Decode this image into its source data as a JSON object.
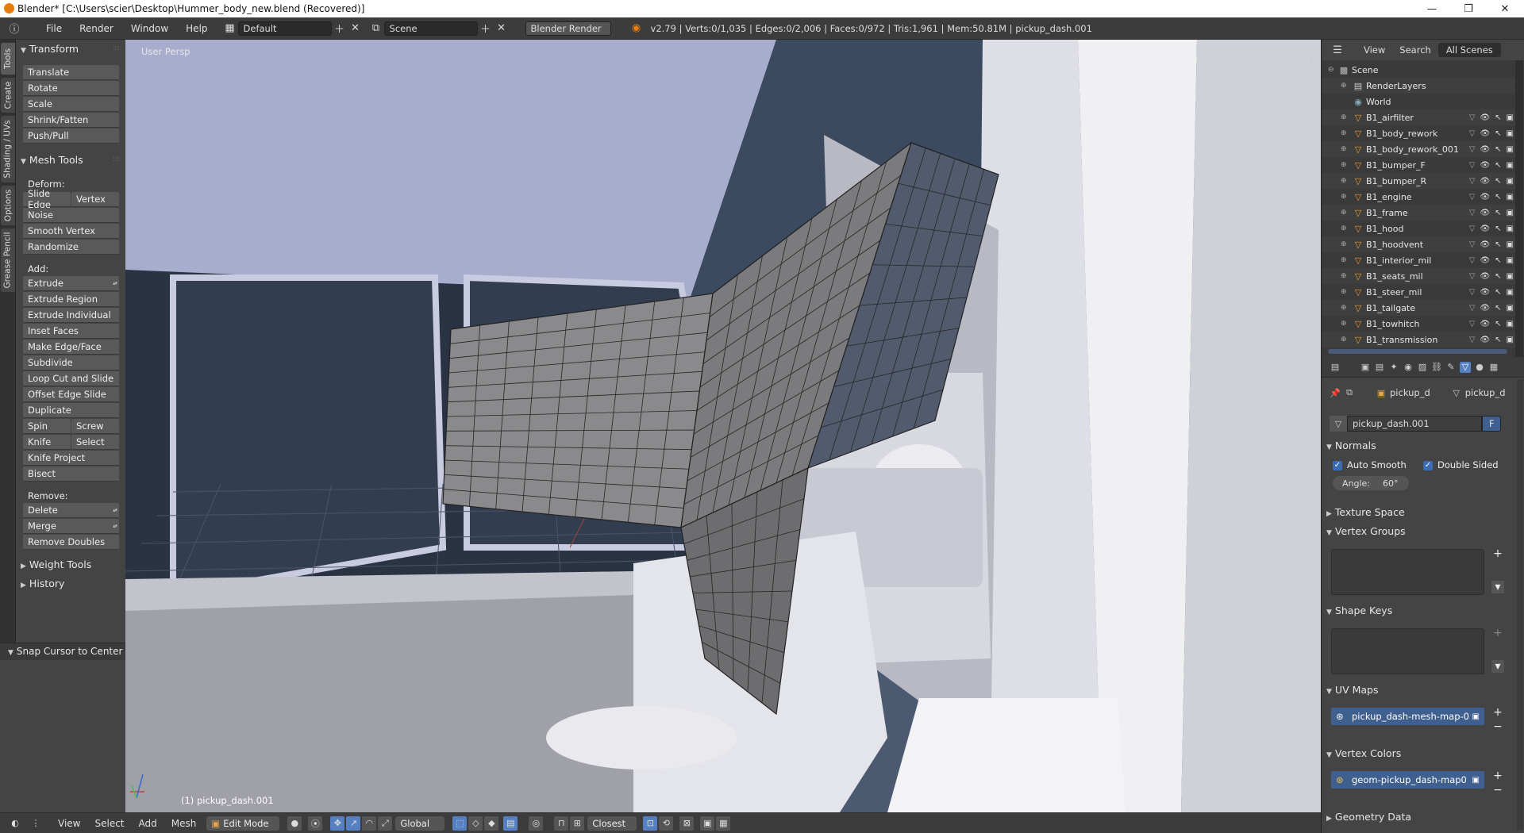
{
  "window": {
    "title": "Blender* [C:\\Users\\scier\\Desktop\\Hummer_body_new.blend (Recovered)]",
    "minimize": "—",
    "maximize": "❐",
    "close": "✕"
  },
  "infobar": {
    "menus": [
      "File",
      "Render",
      "Window",
      "Help"
    ],
    "layout": "Default",
    "scene": "Scene",
    "engine": "Blender Render",
    "stats": "v2.79 | Verts:0/1,035 | Edges:0/2,006 | Faces:0/972 | Tris:1,961 | Mem:50.81M | pickup_dash.001"
  },
  "tool_tabs": [
    "Tools",
    "Create",
    "Shading / UVs",
    "Options",
    "Grease Pencil"
  ],
  "toolshelf": {
    "transform": {
      "title": "Transform",
      "buttons": [
        "Translate",
        "Rotate",
        "Scale",
        "Shrink/Fatten",
        "Push/Pull"
      ]
    },
    "mesh_tools": {
      "title": "Mesh Tools",
      "deform_label": "Deform:",
      "slide_edge": "Slide Edge",
      "vertex": "Vertex",
      "noise": "Noise",
      "smooth_vertex": "Smooth Vertex",
      "randomize": "Randomize",
      "add_label": "Add:",
      "extrude": "Extrude",
      "extrude_region": "Extrude Region",
      "extrude_individual": "Extrude Individual",
      "inset_faces": "Inset Faces",
      "make_edge_face": "Make Edge/Face",
      "subdivide": "Subdivide",
      "loop_cut": "Loop Cut and Slide",
      "offset_edge": "Offset Edge Slide",
      "duplicate": "Duplicate",
      "spin": "Spin",
      "screw": "Screw",
      "knife": "Knife",
      "select": "Select",
      "knife_project": "Knife Project",
      "bisect": "Bisect",
      "remove_label": "Remove:",
      "delete": "Delete",
      "merge": "Merge",
      "remove_doubles": "Remove Doubles"
    },
    "weight_tools": "Weight Tools",
    "history": "History",
    "snap_cursor": "Snap Cursor to Center"
  },
  "viewport": {
    "view_label": "User Persp",
    "object_label": "(1) pickup_dash.001"
  },
  "bottombar": {
    "menus": [
      "View",
      "Select",
      "Add",
      "Mesh"
    ],
    "mode": "Edit Mode",
    "orientation": "Global",
    "snap_target": "Closest"
  },
  "outliner": {
    "tabs": [
      "View",
      "Search",
      "All Scenes"
    ],
    "scene": "Scene",
    "renderlayers": "RenderLayers",
    "world": "World",
    "objects": [
      "B1_airfilter",
      "B1_body_rework",
      "B1_body_rework_001",
      "B1_bumper_F",
      "B1_bumper_R",
      "B1_engine",
      "B1_frame",
      "B1_hood",
      "B1_hoodvent",
      "B1_interior_mil",
      "B1_seats_mil",
      "B1_steer_mil",
      "B1_tailgate",
      "B1_towhitch",
      "B1_transmission"
    ]
  },
  "properties": {
    "breadcrumb_object": "pickup_d",
    "breadcrumb_mesh": "pickup_d",
    "mesh_name": "pickup_dash.001",
    "fake_user": "F",
    "normals": "Normals",
    "auto_smooth": "Auto Smooth",
    "double_sided": "Double Sided",
    "angle_label": "Angle:",
    "angle_value": "60°",
    "texture_space": "Texture Space",
    "vertex_groups": "Vertex Groups",
    "shape_keys": "Shape Keys",
    "uv_maps": "UV Maps",
    "uv_map_item": "pickup_dash-mesh-map-0",
    "vertex_colors": "Vertex Colors",
    "vertex_color_item": "geom-pickup_dash-map0",
    "geometry_data": "Geometry Data"
  },
  "colors": {
    "accent": "#5680c2",
    "list_selection": "#3f5f8f",
    "mesh_icon": "#ee9b2e"
  }
}
